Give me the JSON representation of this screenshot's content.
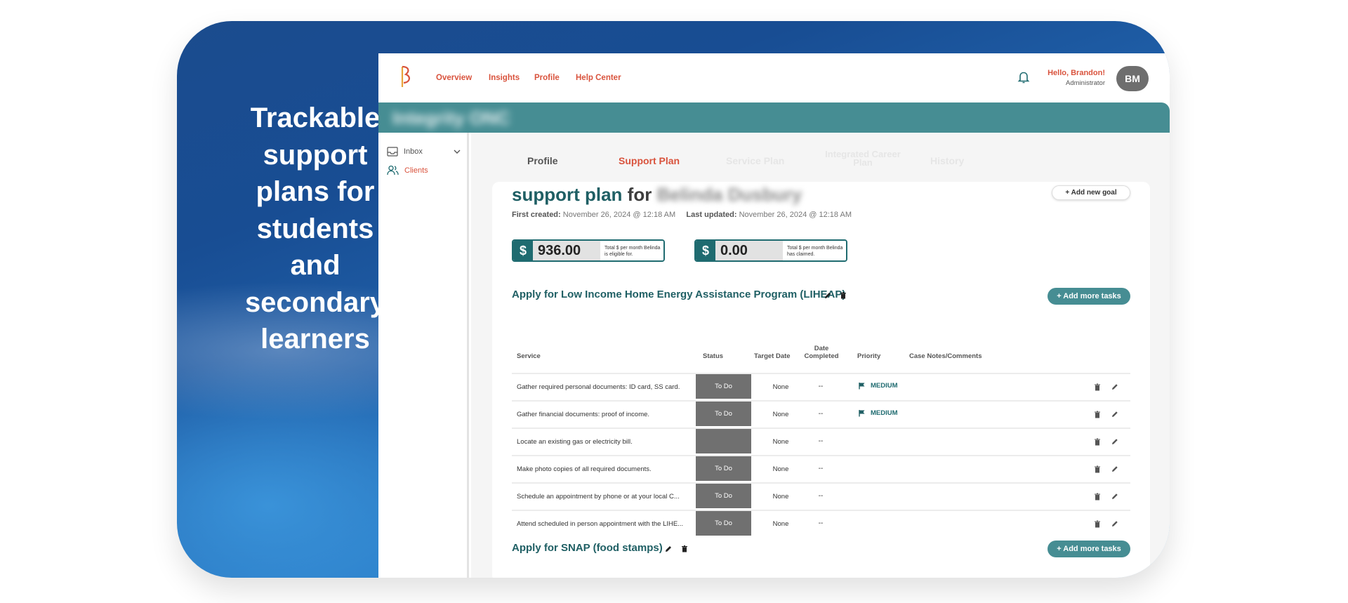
{
  "hero": {
    "tagline_lines": [
      "Trackable",
      "support",
      "plans for",
      "students",
      "and",
      "secondary",
      "learners"
    ]
  },
  "topnav": {
    "links": [
      "Overview",
      "Insights",
      "Profile",
      "Help Center"
    ],
    "greeting": "Hello, Brandon!",
    "role": "Administrator",
    "avatar_initials": "BM"
  },
  "banner": {
    "org_name": "Integrity ONC"
  },
  "sidebar": {
    "items": [
      {
        "label": "Inbox",
        "icon": "inbox-icon"
      },
      {
        "label": "Clients",
        "icon": "clients-icon"
      }
    ]
  },
  "tabs": [
    "Profile",
    "Support Plan",
    "Service Plan",
    "Integrated Career Plan",
    "History"
  ],
  "plan": {
    "title_prefix": "support plan",
    "title_for": "for",
    "client_name": "Belinda Dusbury",
    "add_goal_label": "+ Add new goal",
    "first_created_label": "First created:",
    "first_created_value": "November 26, 2024 @ 12:18 AM",
    "last_updated_label": "Last updated:",
    "last_updated_value": "November 26, 2024 @ 12:18 AM",
    "eligible": {
      "symbol": "$",
      "amount": "936.00",
      "note": "Total $ per month Belinda is eligible for."
    },
    "claimed": {
      "symbol": "$",
      "amount": "0.00",
      "note": "Total $ per month Belinda has claimed."
    }
  },
  "goals": [
    {
      "title": "Apply for Low Income Home Energy Assistance Program (LIHEAP)",
      "add_tasks_label": "+ Add more tasks"
    },
    {
      "title": "Apply for SNAP (food stamps)",
      "add_tasks_label": "+ Add more tasks"
    }
  ],
  "table": {
    "headers": {
      "service": "Service",
      "status": "Status",
      "target": "Target Date",
      "date_completed": "Date Completed",
      "priority": "Priority",
      "notes": "Case Notes/Comments"
    },
    "rows": [
      {
        "service": "Gather required personal documents: ID card, SS card.",
        "status": "To Do",
        "target": "None",
        "completed": "--",
        "priority": "MEDIUM"
      },
      {
        "service": "Gather financial documents: proof of income.",
        "status": "To Do",
        "target": "None",
        "completed": "--",
        "priority": "MEDIUM"
      },
      {
        "service": "Locate an existing gas or electricity bill.",
        "status": "",
        "target": "None",
        "completed": "--",
        "priority": ""
      },
      {
        "service": "Make photo copies of all required documents.",
        "status": "To Do",
        "target": "None",
        "completed": "--",
        "priority": ""
      },
      {
        "service": "Schedule an appointment by phone or at your local C...",
        "status": "To Do",
        "target": "None",
        "completed": "--",
        "priority": ""
      },
      {
        "service": "Attend scheduled in person appointment with the LIHE...",
        "status": "To Do",
        "target": "None",
        "completed": "--",
        "priority": ""
      }
    ]
  },
  "colors": {
    "accent_red": "#d9533d",
    "teal_dark": "#1f5f64",
    "teal_mid": "#468d93",
    "status_gray": "#707070"
  }
}
